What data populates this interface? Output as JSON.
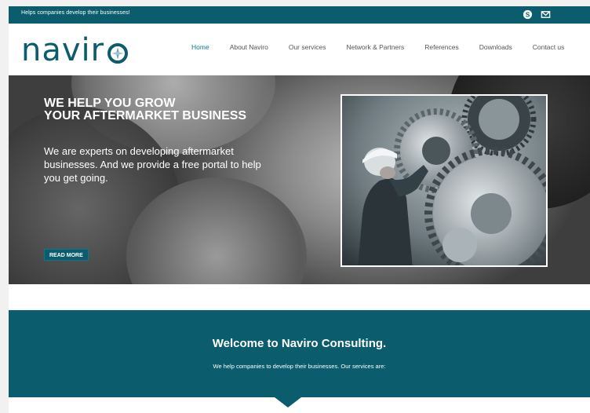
{
  "topbar": {
    "tagline": "Helps companies develop their businesses!",
    "icons": [
      "skype-icon",
      "mail-icon"
    ]
  },
  "header": {
    "logo_text": "navir",
    "nav": [
      {
        "label": "Home",
        "active": true
      },
      {
        "label": "About Naviro",
        "active": false
      },
      {
        "label": "Our services",
        "active": false
      },
      {
        "label": "Network & Partners",
        "active": false
      },
      {
        "label": "References",
        "active": false
      },
      {
        "label": "Downloads",
        "active": false
      },
      {
        "label": "Contact us",
        "active": false
      }
    ]
  },
  "hero": {
    "title_line1": "WE HELP YOU GROW",
    "title_line2": "YOUR AFTERMARKET BUSINESS",
    "subtitle": "We are experts on developing aftermarket businesses. And we provide a free portal to help you get going.",
    "button": "READ MORE"
  },
  "welcome": {
    "title": "Welcome to Naviro Consulting.",
    "subtitle": "We help companies to develop their businesses. Our services are:"
  },
  "colors": {
    "brand": "#0b5d6e",
    "nav_active": "#0b7a8e"
  }
}
